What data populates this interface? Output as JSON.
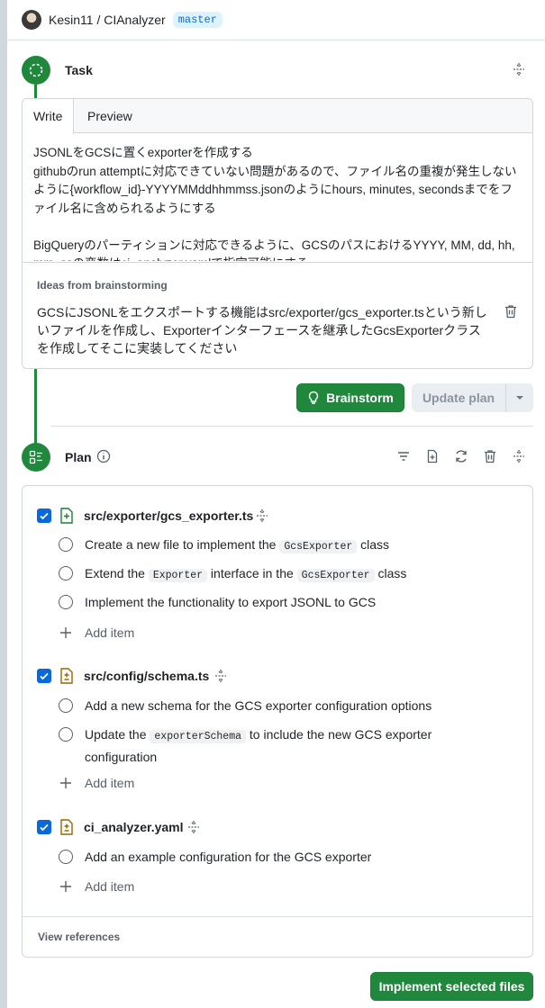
{
  "header": {
    "repo": "Kesin11 / CIAnalyzer",
    "branch": "master"
  },
  "task": {
    "title": "Task",
    "tabs": [
      "Write",
      "Preview"
    ],
    "text": "JSONLをGCSに置くexporterを作成する\ngithubのrun attemptに対応できていない問題があるので、ファイル名の重複が発生しないように{workflow_id}-YYYYMMddhhmmss.jsonのようにhours, minutes, secondsまでをファイル名に含められるようにする\n\nBigQueryのパーティションに対応できるように、GCSのパスにおけるYYYY, MM, dd, hh, mm, ssの変数はci_analyzer.yamlで指定可能にする",
    "ideas_label": "Ideas from brainstorming",
    "ideas_text": "GCSにJSONLをエクスポートする機能はsrc/exporter/gcs_exporter.tsという新しいファイルを作成し、Exporterインターフェースを継承したGcsExporterクラスを作成してそこに実装してください"
  },
  "actions": {
    "brainstorm_label": "Brainstorm",
    "update_plan_label": "Update plan"
  },
  "plan": {
    "title": "Plan",
    "files": [
      {
        "name": "src/exporter/gcs_exporter.ts",
        "items": [
          {
            "before": "Create a new file to implement the ",
            "code": "GcsExporter",
            "after": " class"
          },
          {
            "before": "Extend the ",
            "code": "Exporter",
            "after": " interface in the ",
            "code2": "GcsExporter",
            "after2": " class"
          },
          {
            "before": "Implement the functionality to export JSONL to GCS"
          }
        ]
      },
      {
        "name": "src/config/schema.ts",
        "items": [
          {
            "before": "Add a new schema for the GCS exporter configuration options"
          },
          {
            "before": "Update the ",
            "code": "exporterSchema",
            "after": " to include the new GCS exporter configuration"
          }
        ]
      },
      {
        "name": "ci_analyzer.yaml",
        "items": [
          {
            "before": "Add an example configuration for the GCS exporter"
          }
        ]
      }
    ],
    "add_item_label": "Add item",
    "view_references_label": "View references"
  },
  "footer": {
    "implement_label": "Implement selected files"
  },
  "colors": {
    "primary_green": "#1f883d",
    "checkbox_blue": "#0969da",
    "added_file_green": "#1a7f37",
    "modified_file_orange": "#9a6700"
  }
}
